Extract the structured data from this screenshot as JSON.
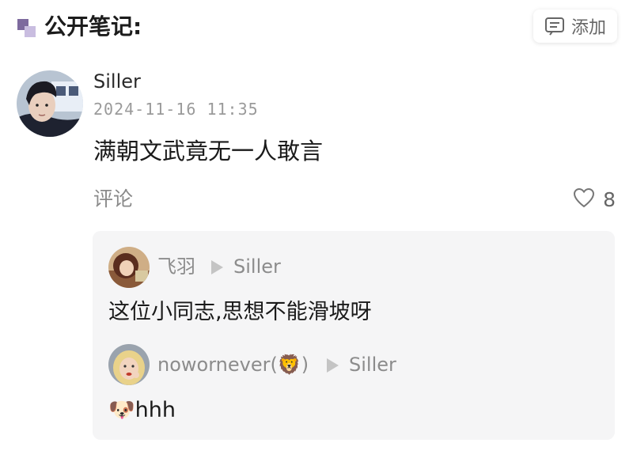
{
  "header": {
    "title": "公开笔记:",
    "add_label": "添加",
    "icon": "note-edit-icon",
    "accent_color": "#7d6a9e"
  },
  "note": {
    "author": "Siller",
    "timestamp": "2024-11-16 11:35",
    "content": "满朝文武竟无一人敢言",
    "comment_label": "评论",
    "like_icon": "heart-outline-icon",
    "like_count": "8"
  },
  "replies": [
    {
      "user": "飞羽",
      "arrow_icon": "reply-arrow-icon",
      "reply_to": "Siller",
      "text": "这位小同志,思想不能滑坡呀"
    },
    {
      "user": "nowornever(🦁)",
      "arrow_icon": "reply-arrow-icon",
      "reply_to": "Siller",
      "text": "🐶hhh"
    }
  ],
  "colors": {
    "reply_background": "#f5f5f6",
    "muted_text": "#8c8c8c"
  }
}
